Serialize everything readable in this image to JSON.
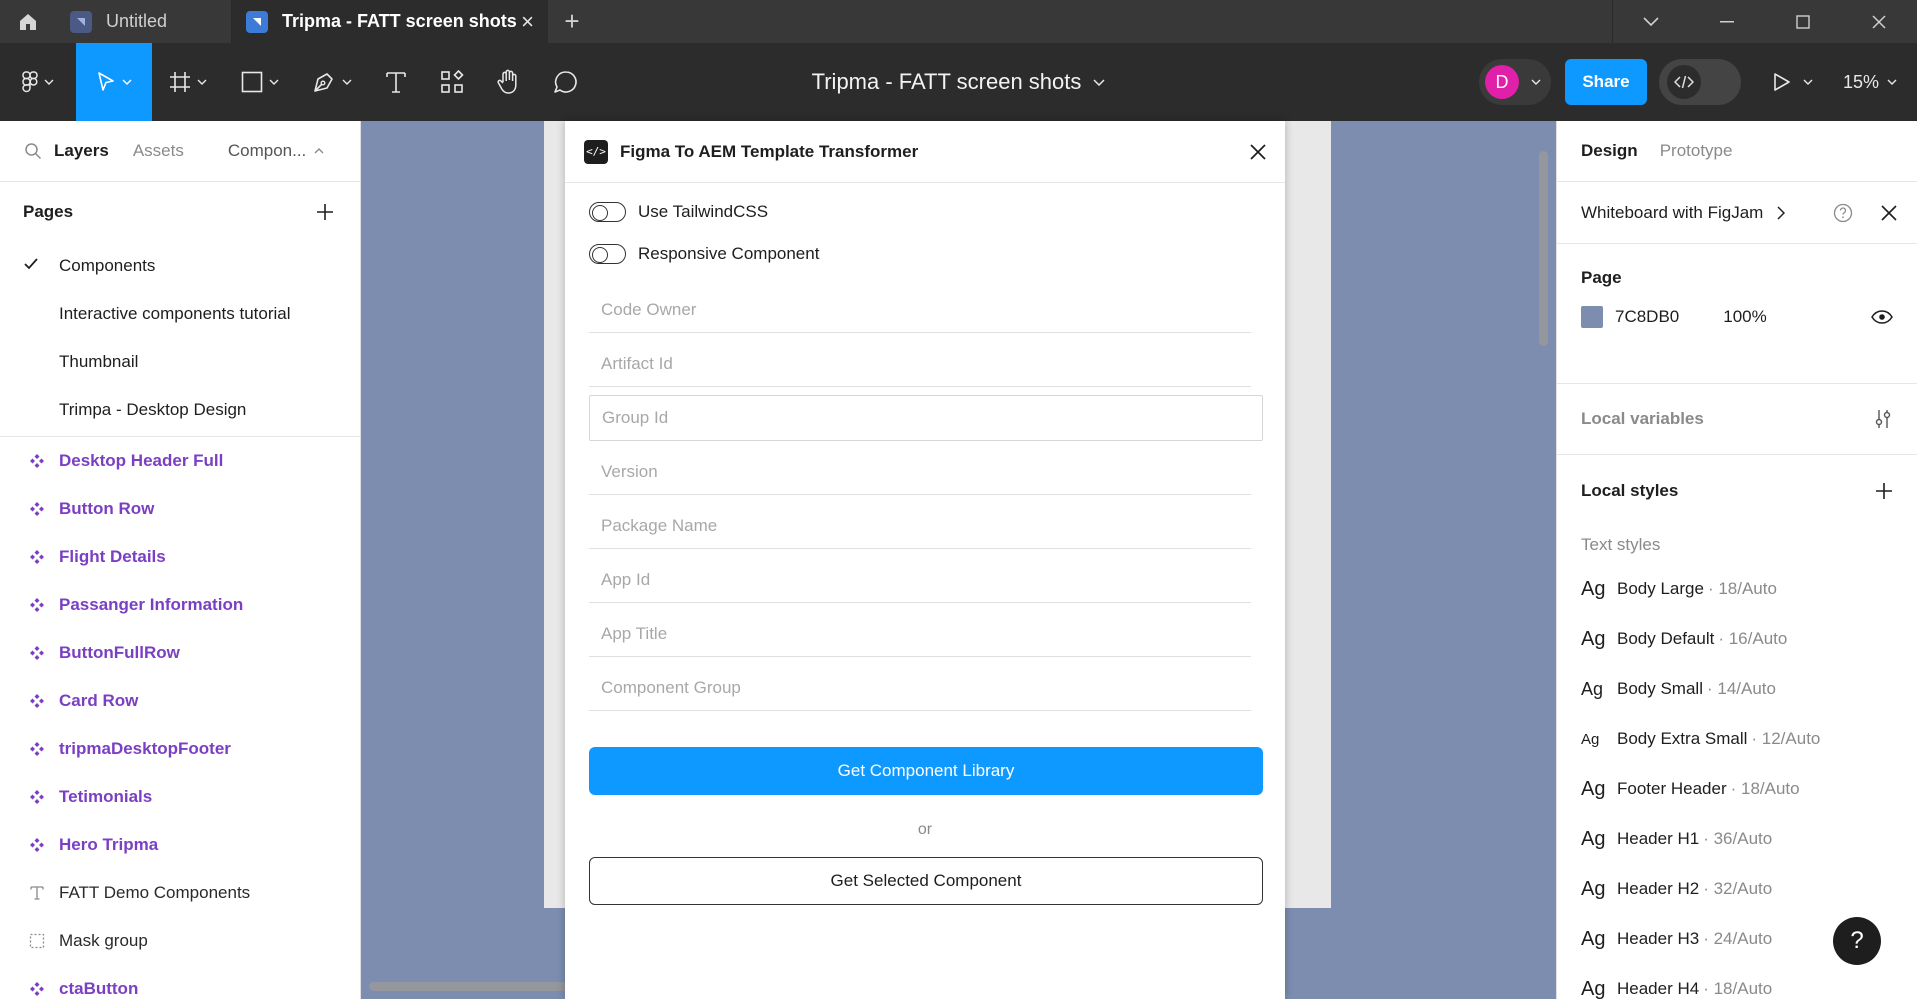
{
  "titlebar": {
    "tabs": [
      {
        "label": "Untitled",
        "active": false
      },
      {
        "label": "Tripma - FATT screen shots",
        "active": true
      }
    ]
  },
  "toolbar": {
    "document_title": "Tripma - FATT screen shots",
    "avatar_initial": "D",
    "share_label": "Share",
    "zoom": "15%"
  },
  "left_panel": {
    "tabs": {
      "layers": "Layers",
      "assets": "Assets",
      "components": "Compon..."
    },
    "pages_title": "Pages",
    "pages": [
      {
        "label": "Components",
        "current": true
      },
      {
        "label": "Interactive components tutorial",
        "current": false
      },
      {
        "label": "Thumbnail",
        "current": false
      },
      {
        "label": "Trimpa - Desktop Design",
        "current": false
      }
    ],
    "layers": [
      {
        "label": "Desktop Header Full",
        "kind": "component"
      },
      {
        "label": "Button Row",
        "kind": "component"
      },
      {
        "label": "Flight Details",
        "kind": "component"
      },
      {
        "label": "Passanger Information",
        "kind": "component"
      },
      {
        "label": "ButtonFullRow",
        "kind": "component"
      },
      {
        "label": "Card Row",
        "kind": "component"
      },
      {
        "label": "tripmaDesktopFooter",
        "kind": "component"
      },
      {
        "label": "Tetimonials",
        "kind": "component"
      },
      {
        "label": "Hero Tripma",
        "kind": "component"
      },
      {
        "label": "FATT Demo Components",
        "kind": "text"
      },
      {
        "label": "Mask group",
        "kind": "mask"
      },
      {
        "label": "ctaButton",
        "kind": "component"
      }
    ]
  },
  "plugin": {
    "title": "Figma To AEM Template Transformer",
    "toggles": [
      {
        "label": "Use TailwindCSS",
        "on": false
      },
      {
        "label": "Responsive Component",
        "on": false
      }
    ],
    "fields": [
      {
        "placeholder": "Code Owner",
        "focused": false
      },
      {
        "placeholder": "Artifact Id",
        "focused": false
      },
      {
        "placeholder": "Group Id",
        "focused": true
      },
      {
        "placeholder": "Version",
        "focused": false
      },
      {
        "placeholder": "Package Name",
        "focused": false
      },
      {
        "placeholder": "App Id",
        "focused": false
      },
      {
        "placeholder": "App Title",
        "focused": false
      },
      {
        "placeholder": "Component Group",
        "focused": false
      }
    ],
    "primary_button": "Get Component Library",
    "or_label": "or",
    "secondary_button": "Get Selected Component"
  },
  "right_panel": {
    "tabs": {
      "design": "Design",
      "prototype": "Prototype"
    },
    "board_label": "Whiteboard with FigJam",
    "page_section": "Page",
    "page_color": "7C8DB0",
    "page_opacity": "100%",
    "local_variables": "Local variables",
    "local_styles": "Local styles",
    "text_styles_label": "Text styles",
    "text_styles": [
      {
        "ag": "Ag",
        "name": "Body Large",
        "meta": "· 18/Auto",
        "size": "large"
      },
      {
        "ag": "Ag",
        "name": "Body Default",
        "meta": "· 16/Auto",
        "size": "large"
      },
      {
        "ag": "Ag",
        "name": "Body Small",
        "meta": "· 14/Auto",
        "size": "medium"
      },
      {
        "ag": "Ag",
        "name": "Body Extra Small",
        "meta": "· 12/Auto",
        "size": "small"
      },
      {
        "ag": "Ag",
        "name": "Footer Header",
        "meta": "· 18/Auto",
        "size": "large"
      },
      {
        "ag": "Ag",
        "name": "Header H1",
        "meta": "· 36/Auto",
        "size": "large"
      },
      {
        "ag": "Ag",
        "name": "Header H2",
        "meta": "· 32/Auto",
        "size": "large"
      },
      {
        "ag": "Ag",
        "name": "Header H3",
        "meta": "· 24/Auto",
        "size": "large"
      },
      {
        "ag": "Ag",
        "name": "Header H4",
        "meta": "· 18/Auto",
        "size": "large"
      }
    ],
    "help_label": "?"
  },
  "colors": {
    "accent": "#0d99ff",
    "component_purple": "#7b3fc4",
    "canvas_bg": "#7c8db0",
    "avatar": "#e020a8"
  }
}
